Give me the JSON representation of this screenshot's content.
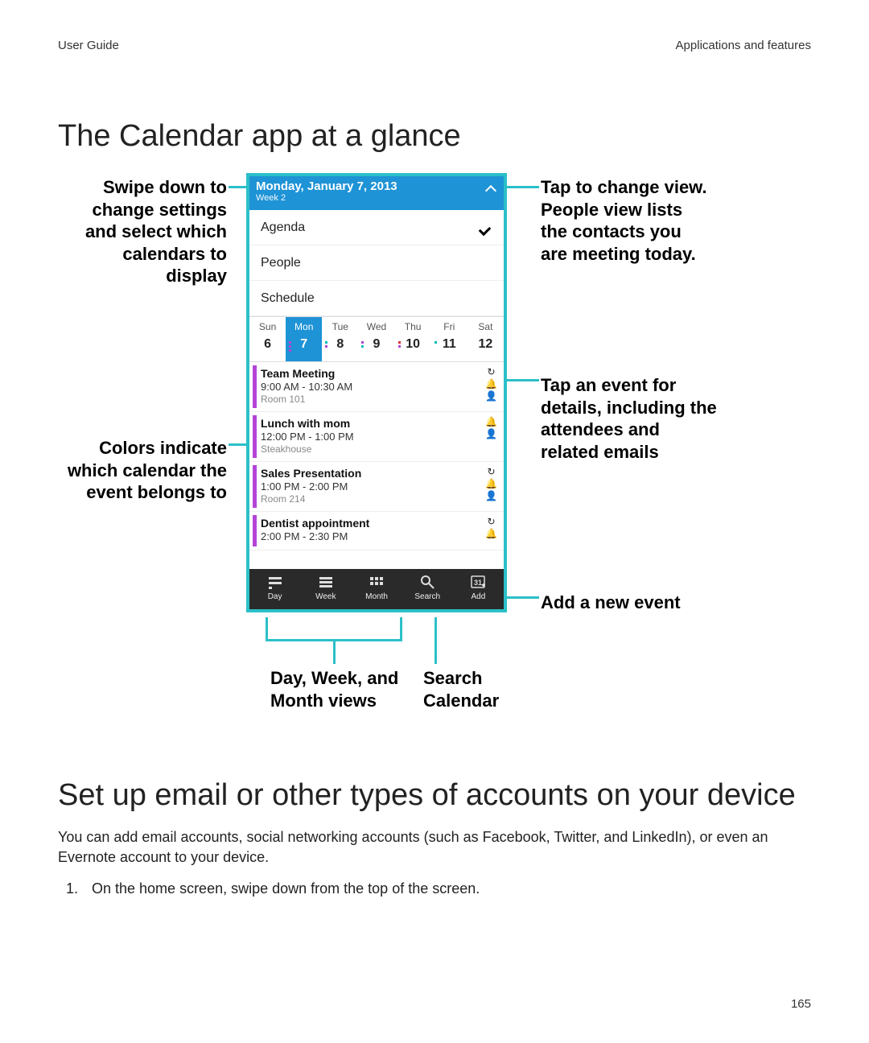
{
  "header_left": "User Guide",
  "header_right": "Applications and features",
  "page_number": "165",
  "section1_title": "The Calendar app at a glance",
  "section2_title": "Set up email or other types of accounts on your device",
  "section2_para": "You can add email accounts, social networking accounts (such as Facebook, Twitter, and LinkedIn), or even an Evernote account to your device.",
  "section2_step1": "On the home screen, swipe down from the top of the screen.",
  "callouts": {
    "swipe": "Swipe down to change settings and select which calendars to display",
    "colors": "Colors indicate which calendar the event belongs to",
    "tap_view": "Tap to change view. People view lists the contacts you are meeting today.",
    "tap_event": "Tap an event for details, including the attendees and related emails",
    "add": "Add a new event",
    "dwm": "Day, Week, and Month views",
    "search": "Search Calendar"
  },
  "phone": {
    "date": "Monday, January 7, 2013",
    "week": "Week 2",
    "views": [
      {
        "label": "Agenda",
        "checked": true
      },
      {
        "label": "People",
        "checked": false
      },
      {
        "label": "Schedule",
        "checked": false
      }
    ],
    "days": [
      {
        "name": "Sun",
        "num": "6",
        "sel": false
      },
      {
        "name": "Mon",
        "num": "7",
        "sel": true
      },
      {
        "name": "Tue",
        "num": "8",
        "sel": false
      },
      {
        "name": "Wed",
        "num": "9",
        "sel": false
      },
      {
        "name": "Thu",
        "num": "10",
        "sel": false
      },
      {
        "name": "Fri",
        "num": "11",
        "sel": false
      },
      {
        "name": "Sat",
        "num": "12",
        "sel": false
      }
    ],
    "events": [
      {
        "title": "Team Meeting",
        "time": "9:00 AM - 10:30 AM",
        "loc": "Room 101",
        "color": "#b344d6",
        "icons": [
          "↻",
          "🔔",
          "👤"
        ]
      },
      {
        "title": "Lunch with mom",
        "time": "12:00 PM - 1:00 PM",
        "loc": "Steakhouse",
        "color": "#b344d6",
        "icons": [
          "🔔",
          "👤"
        ]
      },
      {
        "title": "Sales Presentation",
        "time": "1:00 PM - 2:00 PM",
        "loc": "Room 214",
        "color": "#b344d6",
        "icons": [
          "↻",
          "🔔",
          "👤"
        ]
      },
      {
        "title": "Dentist appointment",
        "time": "2:00 PM - 2:30 PM",
        "loc": "",
        "color": "#b344d6",
        "icons": [
          "↻",
          "🔔"
        ]
      }
    ],
    "tabs": [
      {
        "label": "Day"
      },
      {
        "label": "Week"
      },
      {
        "label": "Month"
      },
      {
        "label": "Search"
      },
      {
        "label": "Add"
      }
    ]
  }
}
